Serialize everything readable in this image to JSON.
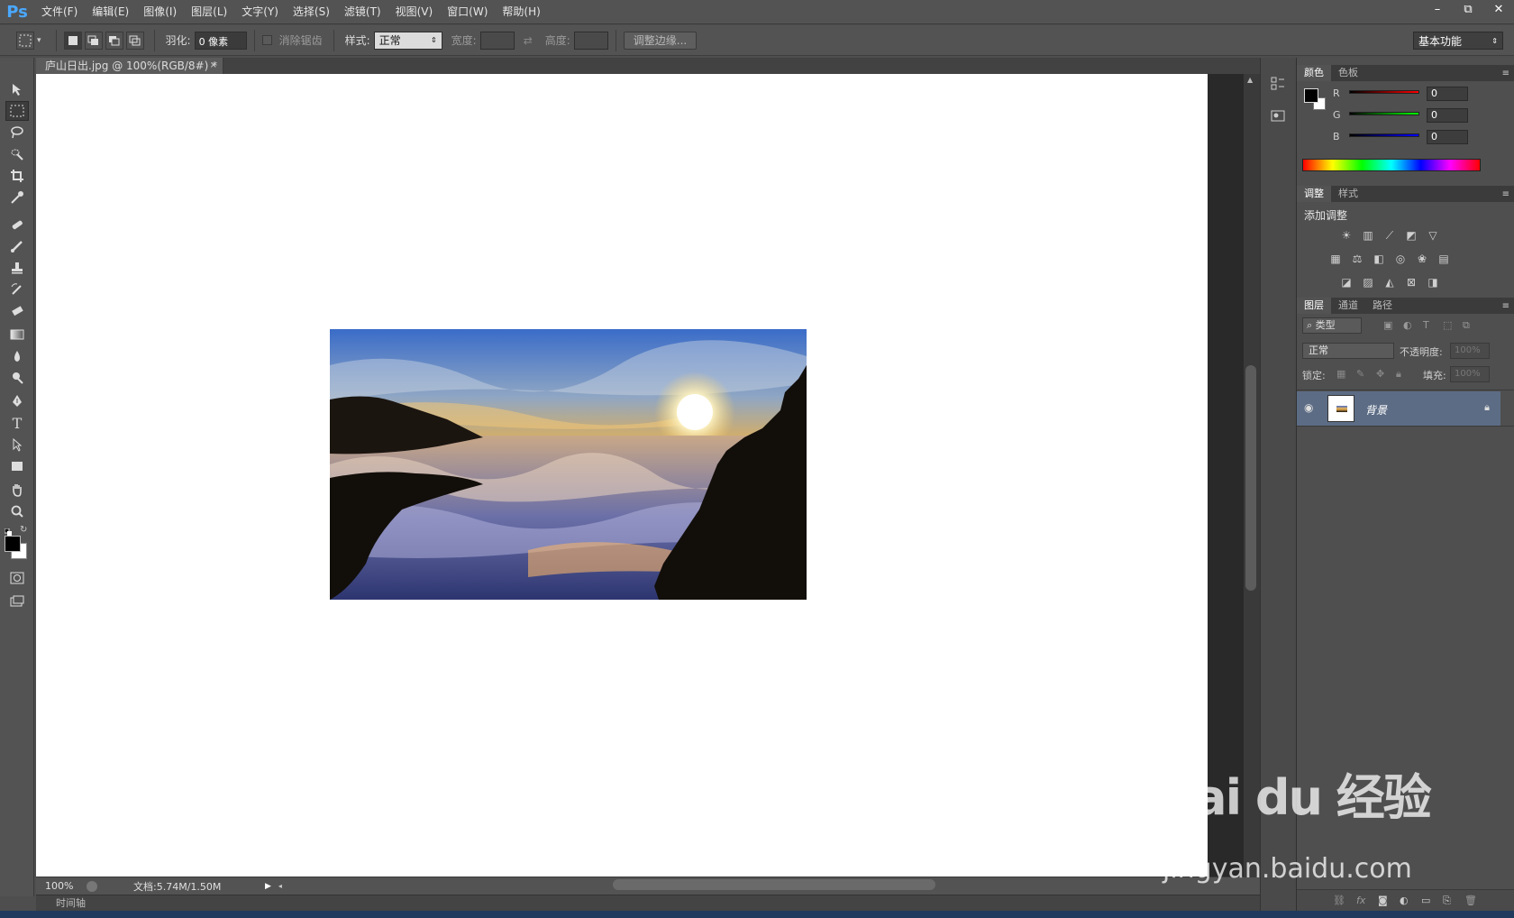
{
  "app": {
    "logo": "Ps"
  },
  "menu": [
    "文件(F)",
    "编辑(E)",
    "图像(I)",
    "图层(L)",
    "文字(Y)",
    "选择(S)",
    "滤镜(T)",
    "视图(V)",
    "窗口(W)",
    "帮助(H)"
  ],
  "window_controls": [
    "–",
    "⧉",
    "✕"
  ],
  "options": {
    "feather_label": "羽化:",
    "feather_value": "0 像素",
    "antialias_label": "消除锯齿",
    "style_label": "样式:",
    "style_value": "正常",
    "width_label": "宽度:",
    "height_label": "高度:",
    "refine_edge": "调整边缘...",
    "workspace": "基本功能"
  },
  "document": {
    "tab_title": "庐山日出.jpg @ 100%(RGB/8#) *",
    "zoom": "100%",
    "doc_info": "文档:5.74M/1.50M",
    "timeline": "时间轴"
  },
  "color_panel": {
    "tabs": [
      "颜色",
      "色板"
    ],
    "channels": [
      {
        "name": "R",
        "value": "0"
      },
      {
        "name": "G",
        "value": "0"
      },
      {
        "name": "B",
        "value": "0"
      }
    ]
  },
  "adjust_panel": {
    "tabs": [
      "调整",
      "样式"
    ],
    "title": "添加调整"
  },
  "layers_panel": {
    "tabs": [
      "图层",
      "通道",
      "路径"
    ],
    "filter": "类型",
    "blend_mode": "正常",
    "opacity_label": "不透明度:",
    "opacity_value": "100%",
    "lock_label": "锁定:",
    "fill_label": "填充:",
    "fill_value": "100%",
    "layers": [
      {
        "name": "背景",
        "visible": true,
        "locked": true
      }
    ]
  },
  "watermark": {
    "brand": "Bai du 经验",
    "url": "jingyan.baidu.com"
  },
  "colors": {
    "accent": "#4aa8ff",
    "panel": "#535353",
    "canvas": "#ffffff",
    "selected_layer": "#5c6c85"
  }
}
